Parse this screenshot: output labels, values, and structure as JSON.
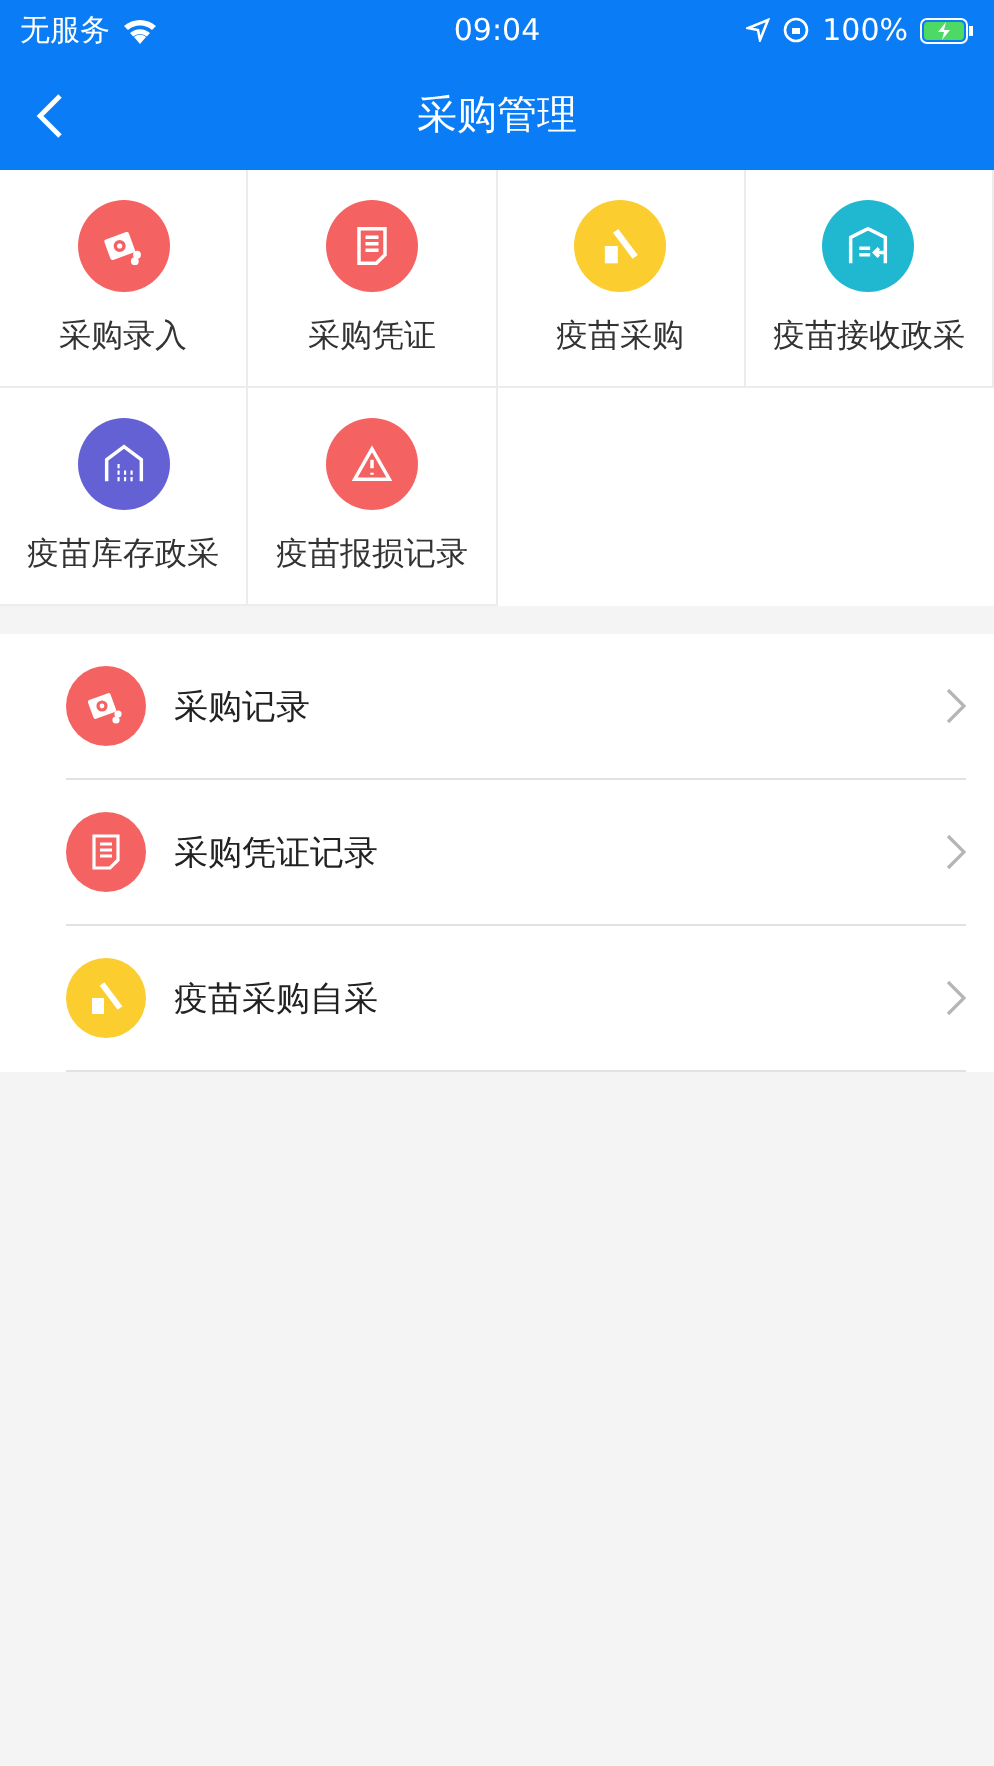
{
  "status_bar": {
    "carrier": "无服务",
    "time": "09:04",
    "battery": "100%"
  },
  "nav_bar": {
    "title": "采购管理"
  },
  "grid": [
    {
      "label": "采购录入",
      "kind": "packet",
      "color": "#f56262"
    },
    {
      "label": "采购凭证",
      "kind": "document",
      "color": "#f56262"
    },
    {
      "label": "疫苗采购",
      "kind": "vaccine",
      "color": "#fbcd2f"
    },
    {
      "label": "疫苗接收政采",
      "kind": "receive",
      "color": "#1fb8d0"
    },
    {
      "label": "疫苗库存政采",
      "kind": "stock",
      "color": "#6461d4"
    },
    {
      "label": "疫苗报损记录",
      "kind": "warning",
      "color": "#f56262"
    }
  ],
  "list": [
    {
      "label": "采购记录",
      "kind": "packet",
      "color": "#f56262"
    },
    {
      "label": "采购凭证记录",
      "kind": "document",
      "color": "#f56262"
    },
    {
      "label": "疫苗采购自采",
      "kind": "vaccine",
      "color": "#fbcd2f"
    }
  ]
}
